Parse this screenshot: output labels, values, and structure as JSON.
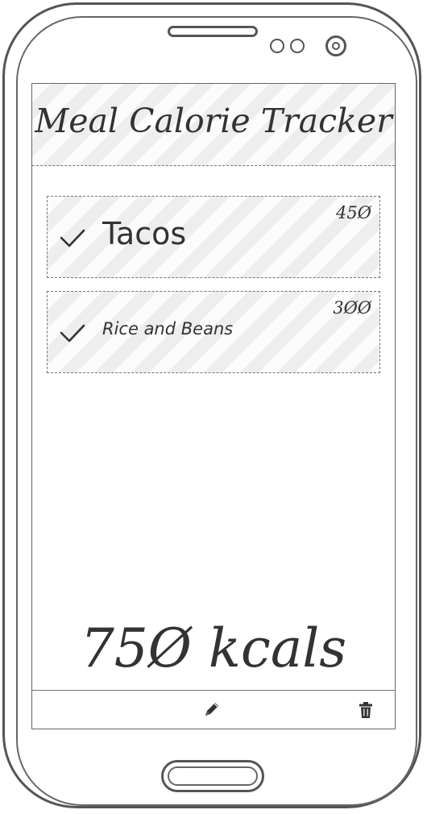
{
  "app": {
    "title": "Meal Calorie Tracker"
  },
  "meals": [
    {
      "name": "Tacos",
      "calories": "45Ø",
      "checked": true,
      "icon": "check-icon"
    },
    {
      "name": "Rice and Beans",
      "calories": "3ØØ",
      "checked": true,
      "icon": "check-icon"
    }
  ],
  "total": {
    "label": "75Ø kcals"
  },
  "toolbar": {
    "edit_icon": "pencil-icon",
    "delete_icon": "trash-icon"
  },
  "colors": {
    "ink": "#333333",
    "card_fill": "#f4f4f4",
    "border": "#777777"
  }
}
